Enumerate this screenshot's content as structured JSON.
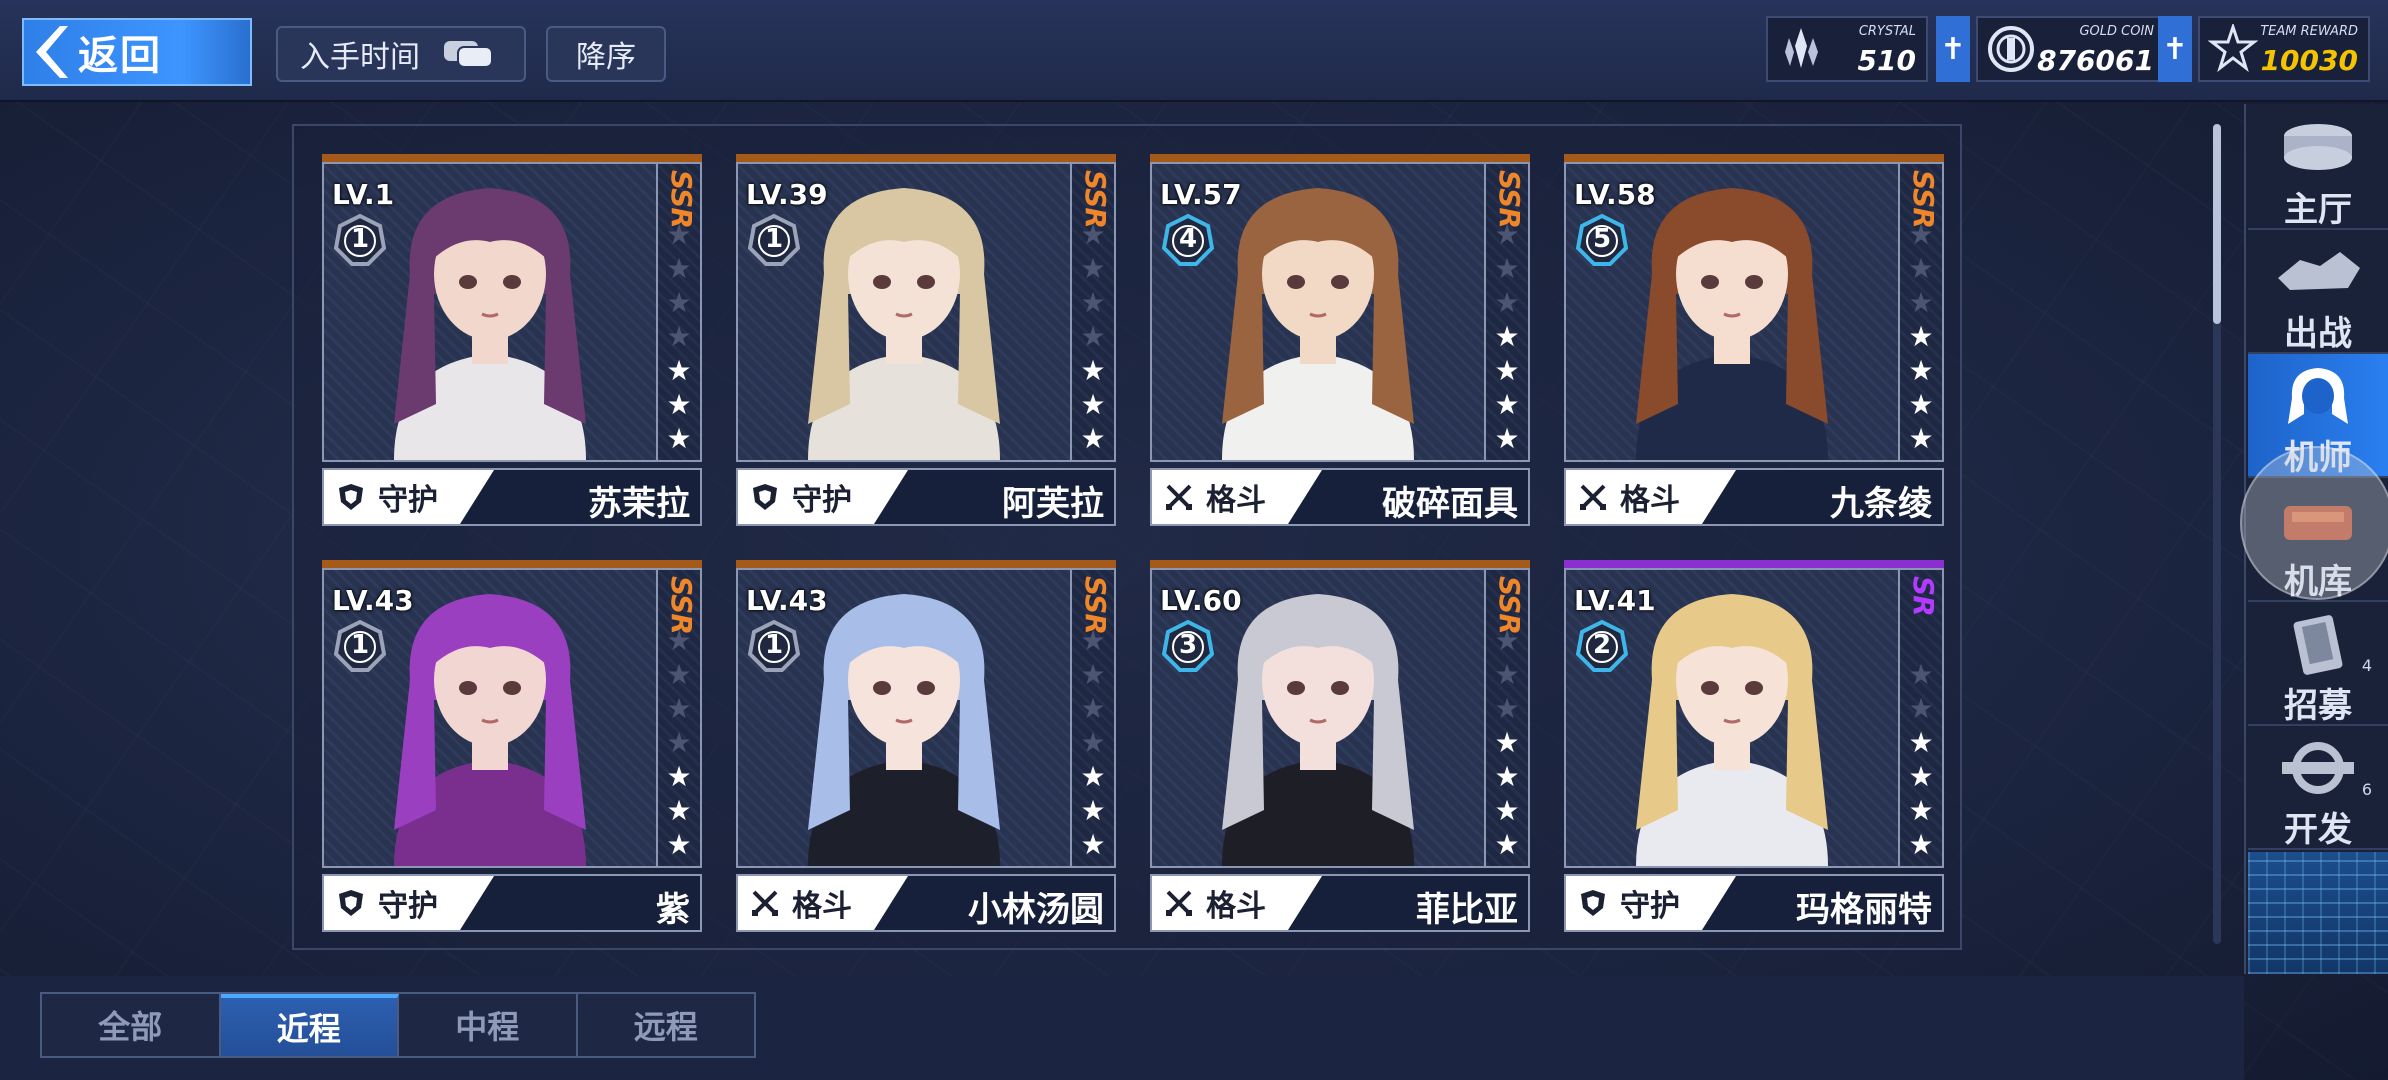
{
  "header": {
    "back_label": "返回",
    "time_label": "入手时间",
    "order_label": "降序"
  },
  "resources": [
    {
      "caption": "CRYSTAL",
      "value": "510",
      "icon": "crystal-icon",
      "color": "#ffffff"
    },
    {
      "caption": "GOLD COIN",
      "value": "876061",
      "icon": "gold-coin-icon",
      "color": "#ffffff"
    },
    {
      "caption": "TEAM REWARD",
      "value": "10030",
      "icon": "team-reward-icon",
      "color": "#f5c400"
    }
  ],
  "cards": [
    {
      "lv": "LV.1",
      "rank": "1",
      "rarity": "SSR",
      "stars": 3,
      "max_stars": 7,
      "role": "守护",
      "role_icon": "shield-icon",
      "name": "苏茉拉",
      "hair": "#6b3a6e",
      "skin": "#f2d8cc",
      "outfit": "#e9e6ea"
    },
    {
      "lv": "LV.39",
      "rank": "1",
      "rarity": "SSR",
      "stars": 3,
      "max_stars": 7,
      "role": "守护",
      "role_icon": "shield-icon",
      "name": "阿芙拉",
      "hair": "#d8c7a2",
      "skin": "#f4e2d6",
      "outfit": "#e6e1da"
    },
    {
      "lv": "LV.57",
      "rank": "4",
      "rarity": "SSR",
      "stars": 4,
      "max_stars": 7,
      "role": "格斗",
      "role_icon": "crossed-swords-icon",
      "name": "破碎面具",
      "hair": "#9a6440",
      "skin": "#f2d9c6",
      "outfit": "#f0f0ee"
    },
    {
      "lv": "LV.58",
      "rank": "5",
      "rarity": "SSR",
      "stars": 4,
      "max_stars": 7,
      "role": "格斗",
      "role_icon": "crossed-swords-icon",
      "name": "九条绫",
      "hair": "#8a4a2c",
      "skin": "#f5ddd0",
      "outfit": "#1f2a48"
    },
    {
      "lv": "LV.43",
      "rank": "1",
      "rarity": "SSR",
      "stars": 3,
      "max_stars": 7,
      "role": "守护",
      "role_icon": "shield-icon",
      "name": "紫",
      "hair": "#9a3fc0",
      "skin": "#f2d6d2",
      "outfit": "#7a2f8f"
    },
    {
      "lv": "LV.43",
      "rank": "1",
      "rarity": "SSR",
      "stars": 3,
      "max_stars": 7,
      "role": "格斗",
      "role_icon": "crossed-swords-icon",
      "name": "小林汤圆",
      "hair": "#a8bde8",
      "skin": "#f6e4dc",
      "outfit": "#1d1f2a"
    },
    {
      "lv": "LV.60",
      "rank": "3",
      "rarity": "SSR",
      "stars": 4,
      "max_stars": 7,
      "role": "格斗",
      "role_icon": "crossed-swords-icon",
      "name": "菲比亚",
      "hair": "#c9c9d4",
      "skin": "#f3e0dc",
      "outfit": "#1e1e26"
    },
    {
      "lv": "LV.41",
      "rank": "2",
      "rarity": "SR",
      "stars": 4,
      "max_stars": 6,
      "role": "守护",
      "role_icon": "shield-icon",
      "name": "玛格丽特",
      "hair": "#e7c98a",
      "skin": "#f6e2d6",
      "outfit": "#e8eaf0"
    }
  ],
  "rarity_colors": {
    "SSR": "#f0862a",
    "SR": "#b23bff"
  },
  "topline_colors": {
    "SSR": "#a65a1a",
    "SR": "#8a2fd0"
  },
  "rank_colors": {
    "1": "#9aa3b8",
    "2": "#3fb6e8",
    "3": "#3fb6e8",
    "4": "#3fb6e8",
    "5": "#3fb6e8"
  },
  "nav": [
    {
      "label": "主厅",
      "icon": "lobby-icon",
      "active": false,
      "badge": ""
    },
    {
      "label": "出战",
      "icon": "sortie-icon",
      "active": false,
      "badge": ""
    },
    {
      "label": "机师",
      "icon": "pilot-icon",
      "active": true,
      "badge": ""
    },
    {
      "label": "机库",
      "icon": "hangar-icon",
      "active": false,
      "badge": ""
    },
    {
      "label": "招募",
      "icon": "recruit-icon",
      "active": false,
      "badge": "4"
    },
    {
      "label": "开发",
      "icon": "develop-icon",
      "active": false,
      "badge": "6"
    }
  ],
  "tabs": [
    {
      "label": "全部",
      "active": false
    },
    {
      "label": "近程",
      "active": true
    },
    {
      "label": "中程",
      "active": false
    },
    {
      "label": "远程",
      "active": false
    }
  ]
}
